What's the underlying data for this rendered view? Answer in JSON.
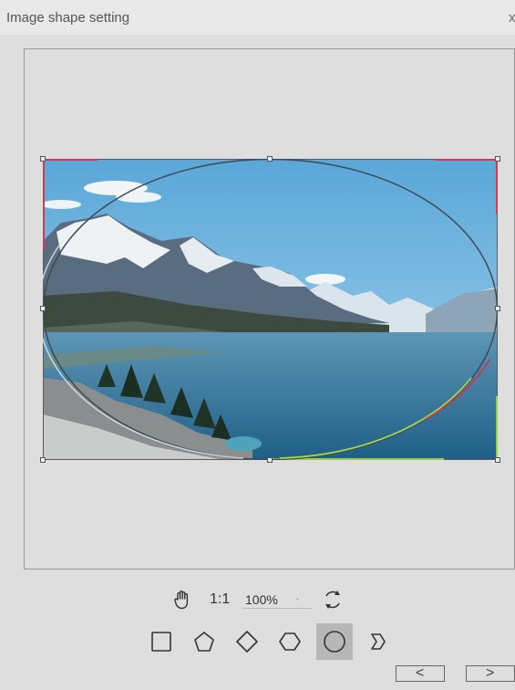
{
  "dialog": {
    "title": "Image shape setting",
    "close_label": "x"
  },
  "zoom_toolbar": {
    "ratio_label": "1:1",
    "zoom_value": "100%",
    "zoom_arrow": "-"
  },
  "shapes": {
    "items": [
      "rectangle",
      "pentagon",
      "diamond",
      "hexagon",
      "ellipse",
      "chevron"
    ],
    "selected": "ellipse"
  },
  "nav": {
    "prev_label": "<",
    "next_label": ">"
  }
}
